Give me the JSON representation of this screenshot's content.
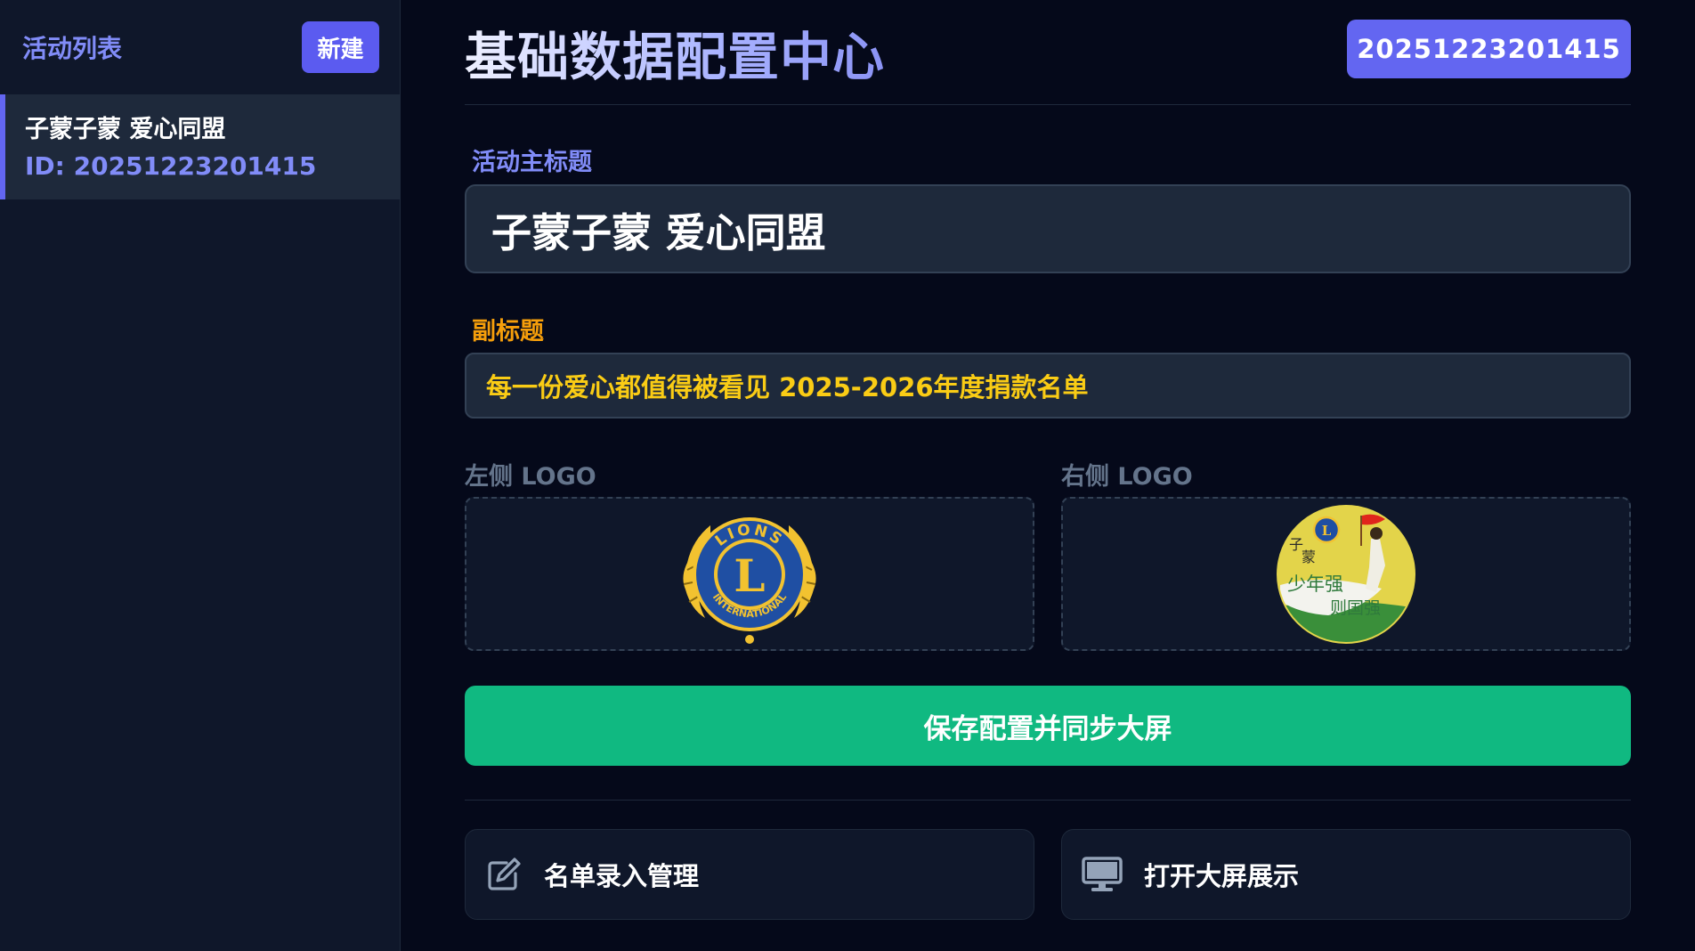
{
  "sidebar": {
    "title": "活动列表",
    "new_label": "新建",
    "items": [
      {
        "name": "子蒙子蒙 爱心同盟",
        "id_text": "ID: 20251223201415"
      }
    ]
  },
  "header": {
    "title": "基础数据配置中心",
    "id_badge": "20251223201415"
  },
  "form": {
    "main_title_label": "活动主标题",
    "main_title_value": "子蒙子蒙 爱心同盟",
    "subtitle_label": "副标题",
    "subtitle_value": "每一份爱心都值得被看见 2025-2026年度捐款名单",
    "left_logo_label": "左侧 LOGO",
    "right_logo_label": "右侧 LOGO"
  },
  "logos": {
    "left": {
      "ring_text": "LIONS",
      "center": "L",
      "bottom_text": "INTERNATIONAL"
    },
    "right": {
      "text1": "子",
      "text2": "蒙",
      "text3": "少年强",
      "text4": "则国强"
    }
  },
  "actions": {
    "save_label": "保存配置并同步大屏",
    "entry_label": "名单录入管理",
    "screen_label": "打开大屏展示"
  },
  "colors": {
    "accent": "#6366f1",
    "save": "#10b981",
    "subtitle": "#facc15",
    "subtitle_label": "#f59e0b"
  }
}
